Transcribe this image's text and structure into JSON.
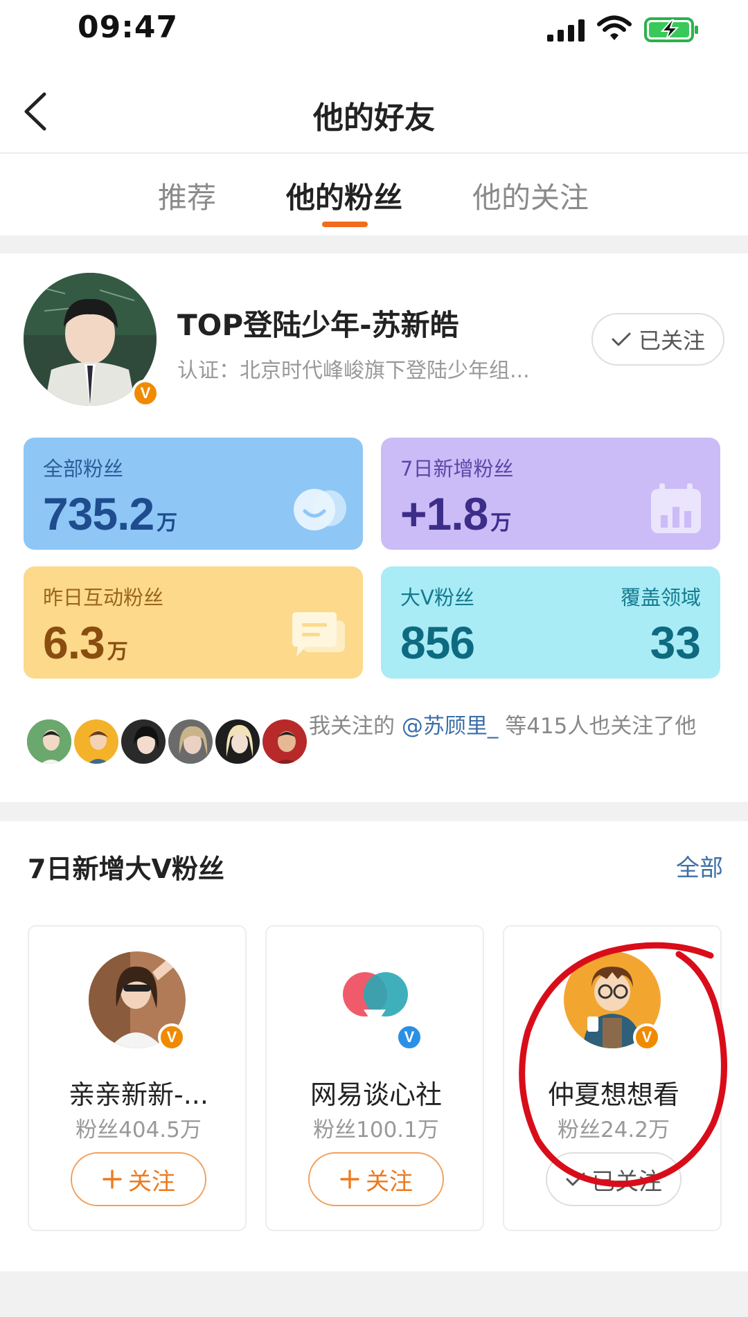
{
  "status": {
    "time": "09:47"
  },
  "nav": {
    "title": "他的好友"
  },
  "tabs": [
    {
      "label": "推荐",
      "active": false
    },
    {
      "label": "他的粉丝",
      "active": true
    },
    {
      "label": "他的关注",
      "active": false
    }
  ],
  "profile": {
    "name": "TOP登陆少年-苏新皓",
    "cert": "认证：北京时代峰峻旗下登陆少年组...",
    "follow_label": "已关注"
  },
  "stats": {
    "all_fans": {
      "label": "全部粉丝",
      "value": "735.2",
      "unit": "万"
    },
    "new_fans_7d": {
      "label": "7日新增粉丝",
      "value": "+1.8",
      "unit": "万"
    },
    "interactive_fans": {
      "label": "昨日互动粉丝",
      "value": "6.3",
      "unit": "万"
    },
    "bigv_fans": {
      "label": "大V粉丝",
      "value": "856"
    },
    "coverage": {
      "label": "覆盖领域",
      "value": "33"
    }
  },
  "mutual": {
    "prefix": "我关注的 ",
    "user": "@苏顾里_",
    "suffix": " 等415人也关注了他"
  },
  "section": {
    "title": "7日新增大V粉丝",
    "all_label": "全部"
  },
  "bigv_cards": [
    {
      "name": "亲亲新新-...",
      "fans": "粉丝404.5万",
      "button": "关注",
      "followed": false,
      "badge": "orange"
    },
    {
      "name": "网易谈心社",
      "fans": "粉丝100.1万",
      "button": "关注",
      "followed": false,
      "badge": "blue"
    },
    {
      "name": "仲夏想想看",
      "fans": "粉丝24.2万",
      "button": "已关注",
      "followed": true,
      "badge": "orange"
    }
  ],
  "colors": {
    "accent": "#f26a1b",
    "link": "#3c6fa8",
    "annotation": "#d90d1a"
  }
}
